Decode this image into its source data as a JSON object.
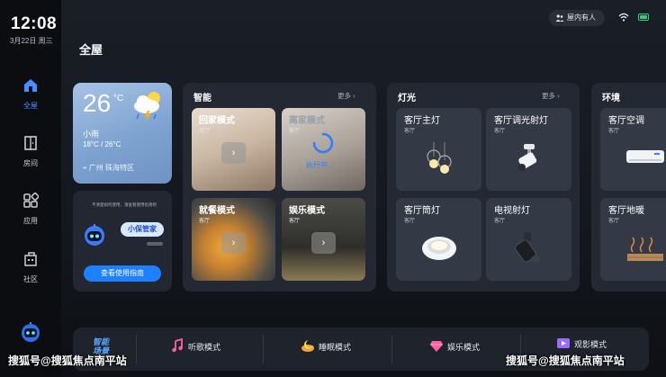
{
  "status": {
    "time": "12:08",
    "date": "3月22日 周三",
    "presence": "屋内有人"
  },
  "sidebar": {
    "items": [
      {
        "label": "全屋",
        "icon": "home-icon"
      },
      {
        "label": "房间",
        "icon": "door-icon"
      },
      {
        "label": "应用",
        "icon": "apps-icon"
      },
      {
        "label": "社区",
        "icon": "community-icon"
      }
    ],
    "active_color": "#4b8cff"
  },
  "page": {
    "title": "全屋"
  },
  "weather": {
    "temp": "26",
    "unit": "°C",
    "condition": "小雨",
    "range": "18°C / 26°C",
    "location": "广州 珠海特区"
  },
  "guide": {
    "tip": "不清楚如何使用，请查看使用指南吧",
    "assistant": "小保管家",
    "button": "查看使用指南"
  },
  "smart": {
    "title": "智能",
    "more": "更多",
    "scenes": [
      {
        "name": "回家模式",
        "room": "客厅"
      },
      {
        "name": "离家模式",
        "room": "客厅",
        "status": "执行中..."
      },
      {
        "name": "就餐模式",
        "room": "客厅"
      },
      {
        "name": "娱乐模式",
        "room": "客厅"
      }
    ]
  },
  "lights": {
    "title": "灯光",
    "more": "更多",
    "devices": [
      {
        "name": "客厅主灯",
        "room": "客厅",
        "icon": "pendant-lamp-icon"
      },
      {
        "name": "客厅调光射灯",
        "room": "客厅",
        "icon": "spotlight-icon"
      },
      {
        "name": "客厅筒灯",
        "room": "客厅",
        "icon": "downlight-icon"
      },
      {
        "name": "电视射灯",
        "room": "客厅",
        "icon": "track-light-icon"
      }
    ]
  },
  "environment": {
    "title": "环境",
    "devices": [
      {
        "name": "客厅空调",
        "room": "客厅",
        "icon": "air-conditioner-icon"
      },
      {
        "name": "客厅地暖",
        "room": "客厅",
        "icon": "floor-heating-icon"
      }
    ]
  },
  "bottom_bar": {
    "smart_label_1": "智能",
    "smart_label_2": "场景",
    "modes": [
      {
        "label": "听歌模式",
        "icon": "music-icon"
      },
      {
        "label": "睡眠模式",
        "icon": "sleep-icon"
      },
      {
        "label": "娱乐模式",
        "icon": "gem-icon"
      },
      {
        "label": "观影模式",
        "icon": "movie-icon"
      }
    ]
  },
  "watermarks": {
    "left": "搜狐号@搜狐焦点南平站",
    "right": "搜狐号@搜狐焦点南平站"
  }
}
